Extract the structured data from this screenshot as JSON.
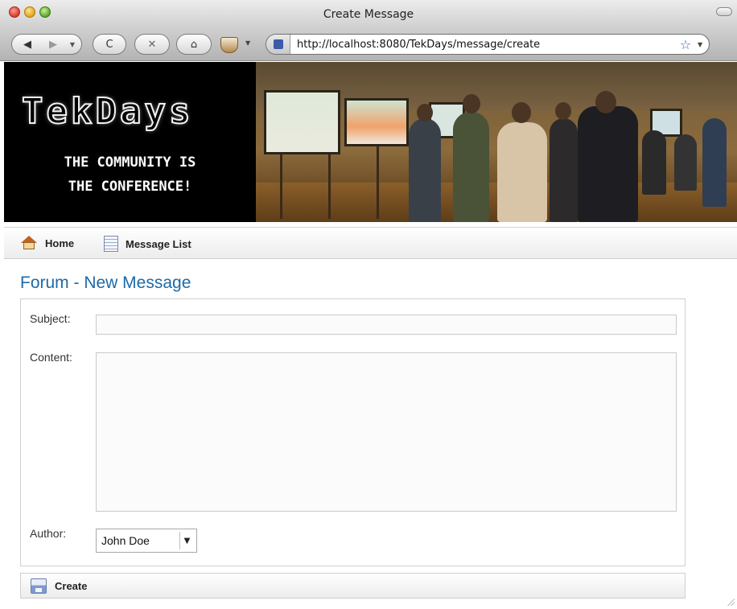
{
  "window": {
    "title": "Create Message"
  },
  "browser": {
    "url": "http://localhost:8080/TekDays/message/create",
    "buttons": {
      "back": "◀",
      "forward": "▶",
      "dropdown": "▼",
      "reload": "C",
      "stop": "✕",
      "home": "⌂",
      "bookmark": "☆"
    }
  },
  "banner": {
    "logo": "TekDays",
    "tagline_line1": "THE COMMUNITY IS",
    "tagline_line2": "THE CONFERENCE!"
  },
  "nav": {
    "home_label": "Home",
    "message_list_label": "Message List"
  },
  "page": {
    "title": "Forum - New Message"
  },
  "form": {
    "subject_label": "Subject:",
    "subject_value": "",
    "content_label": "Content:",
    "content_value": "",
    "author_label": "Author:",
    "author_selected": "John Doe",
    "author_arrow": "▼",
    "create_label": "Create"
  },
  "icons": {
    "home": "house-icon",
    "message_list": "document-icon",
    "create": "save-icon"
  }
}
